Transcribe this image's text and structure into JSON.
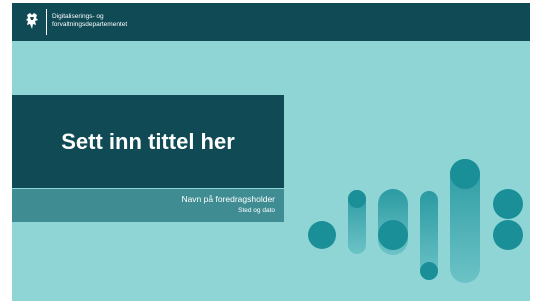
{
  "header": {
    "organization_line1": "Digitaliserings- og",
    "organization_line2": "forvaltningsdepartementet",
    "emblem": "norwegian-lion-emblem"
  },
  "title_block": {
    "title": "Sett inn tittel her",
    "presenter": "Navn på foredragsholder",
    "place_date": "Sted og dato"
  },
  "colors": {
    "slide_background": "#8fd5d6",
    "header_background": "#0f4a55",
    "title_box": "#0f4a55",
    "subtitle_box": "#3f8c93",
    "accent_dark": "#1a8f98",
    "accent_light": "#5ab8bd"
  }
}
